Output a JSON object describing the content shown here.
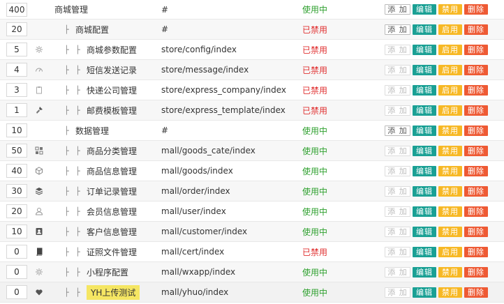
{
  "colors": {
    "status_on": "#2ea02e",
    "status_off": "#e03030",
    "edit_button": "#1aa094",
    "toggle_button": "#f7b824",
    "delete_button": "#ee5a34",
    "highlight": "#f5e663"
  },
  "rows": [
    {
      "sort": "400",
      "icon": "",
      "level": 0,
      "title": "商城管理",
      "url": "#",
      "status": "使用中",
      "enabled": true,
      "add_label": "添 加",
      "add_enabled": true,
      "edit_label": "编辑",
      "toggle_label": "禁用",
      "delete_label": "删除",
      "selected": false,
      "highlight": false
    },
    {
      "sort": "20",
      "icon": "",
      "level": 1,
      "title": "商城配置",
      "url": "#",
      "status": "已禁用",
      "enabled": false,
      "add_label": "添 加",
      "add_enabled": true,
      "edit_label": "编辑",
      "toggle_label": "启用",
      "delete_label": "删除",
      "selected": false,
      "highlight": false
    },
    {
      "sort": "5",
      "icon": "gear-icon",
      "level": 2,
      "title": "商城参数配置",
      "url": "store/config/index",
      "status": "已禁用",
      "enabled": false,
      "add_label": "添 加",
      "add_enabled": false,
      "edit_label": "编辑",
      "toggle_label": "启用",
      "delete_label": "删除",
      "selected": false,
      "highlight": false
    },
    {
      "sort": "4",
      "icon": "dashboard-icon",
      "level": 2,
      "title": "短信发送记录",
      "url": "store/message/index",
      "status": "已禁用",
      "enabled": false,
      "add_label": "添 加",
      "add_enabled": false,
      "edit_label": "编辑",
      "toggle_label": "启用",
      "delete_label": "删除",
      "selected": false,
      "highlight": false
    },
    {
      "sort": "3",
      "icon": "clipboard-icon",
      "level": 2,
      "title": "快递公司管理",
      "url": "store/express_company/index",
      "status": "已禁用",
      "enabled": false,
      "add_label": "添 加",
      "add_enabled": false,
      "edit_label": "编辑",
      "toggle_label": "启用",
      "delete_label": "删除",
      "selected": false,
      "highlight": false
    },
    {
      "sort": "1",
      "icon": "brush-icon",
      "level": 2,
      "title": "邮费模板管理",
      "url": "store/express_template/index",
      "status": "已禁用",
      "enabled": false,
      "add_label": "添 加",
      "add_enabled": false,
      "edit_label": "编辑",
      "toggle_label": "启用",
      "delete_label": "删除",
      "selected": false,
      "highlight": false
    },
    {
      "sort": "10",
      "icon": "",
      "level": 1,
      "title": "数据管理",
      "url": "#",
      "status": "使用中",
      "enabled": true,
      "add_label": "添 加",
      "add_enabled": true,
      "edit_label": "编辑",
      "toggle_label": "禁用",
      "delete_label": "删除",
      "selected": false,
      "highlight": false
    },
    {
      "sort": "50",
      "icon": "category-icon",
      "level": 2,
      "title": "商品分类管理",
      "url": "mall/goods_cate/index",
      "status": "使用中",
      "enabled": true,
      "add_label": "添 加",
      "add_enabled": false,
      "edit_label": "编辑",
      "toggle_label": "禁用",
      "delete_label": "删除",
      "selected": false,
      "highlight": false
    },
    {
      "sort": "40",
      "icon": "cube-icon",
      "level": 2,
      "title": "商品信息管理",
      "url": "mall/goods/index",
      "status": "使用中",
      "enabled": true,
      "add_label": "添 加",
      "add_enabled": false,
      "edit_label": "编辑",
      "toggle_label": "禁用",
      "delete_label": "删除",
      "selected": false,
      "highlight": false
    },
    {
      "sort": "30",
      "icon": "layers-icon",
      "level": 2,
      "title": "订单记录管理",
      "url": "mall/order/index",
      "status": "使用中",
      "enabled": true,
      "add_label": "添 加",
      "add_enabled": false,
      "edit_label": "编辑",
      "toggle_label": "禁用",
      "delete_label": "删除",
      "selected": false,
      "highlight": false
    },
    {
      "sort": "20",
      "icon": "user-icon",
      "level": 2,
      "title": "会员信息管理",
      "url": "mall/user/index",
      "status": "使用中",
      "enabled": true,
      "add_label": "添 加",
      "add_enabled": false,
      "edit_label": "编辑",
      "toggle_label": "禁用",
      "delete_label": "删除",
      "selected": false,
      "highlight": false
    },
    {
      "sort": "10",
      "icon": "contact-icon",
      "level": 2,
      "title": "客户信息管理",
      "url": "mall/customer/index",
      "status": "使用中",
      "enabled": true,
      "add_label": "添 加",
      "add_enabled": false,
      "edit_label": "编辑",
      "toggle_label": "禁用",
      "delete_label": "删除",
      "selected": false,
      "highlight": false
    },
    {
      "sort": "0",
      "icon": "book-icon",
      "level": 2,
      "title": "证照文件管理",
      "url": "mall/cert/index",
      "status": "已禁用",
      "enabled": false,
      "add_label": "添 加",
      "add_enabled": false,
      "edit_label": "编辑",
      "toggle_label": "启用",
      "delete_label": "删除",
      "selected": false,
      "highlight": false
    },
    {
      "sort": "0",
      "icon": "gear-icon",
      "level": 2,
      "title": "小程序配置",
      "url": "mall/wxapp/index",
      "status": "使用中",
      "enabled": true,
      "add_label": "添 加",
      "add_enabled": false,
      "edit_label": "编辑",
      "toggle_label": "禁用",
      "delete_label": "删除",
      "selected": false,
      "highlight": false
    },
    {
      "sort": "0",
      "icon": "heart-icon",
      "level": 2,
      "title": "YH上传测试",
      "url": "mall/yhuo/index",
      "status": "使用中",
      "enabled": true,
      "add_label": "添 加",
      "add_enabled": false,
      "edit_label": "编辑",
      "toggle_label": "禁用",
      "delete_label": "删除",
      "selected": true,
      "highlight": true
    }
  ],
  "tree_separator": "├"
}
